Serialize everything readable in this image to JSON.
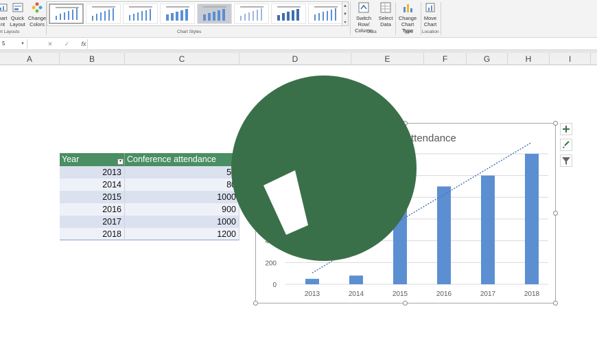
{
  "ribbon": {
    "add_element": {
      "line1": "hart",
      "line2": "nt"
    },
    "quick_layout": {
      "line1": "Quick",
      "line2": "Layout"
    },
    "change_colors": {
      "line1": "Change",
      "line2": "Colors"
    },
    "chart_layouts_label": "rt Layouts",
    "chart_styles_label": "Chart Styles",
    "switch_row_column": {
      "line1": "Switch Row/",
      "line2": "Column"
    },
    "select_data": {
      "line1": "Select",
      "line2": "Data"
    },
    "data_group_label": "Data",
    "change_chart_type": {
      "line1": "Change",
      "line2": "Chart Type"
    },
    "type_group_label": "Type",
    "move_chart": {
      "line1": "Move",
      "line2": "Chart"
    },
    "location_group_label": "Location"
  },
  "formula_bar": {
    "name_box": "5",
    "cancel": "✕",
    "enter": "✓",
    "fx": "fx",
    "value": ""
  },
  "columns": [
    "A",
    "B",
    "C",
    "D",
    "E",
    "F",
    "G",
    "H",
    "I"
  ],
  "table": {
    "headers": [
      "Year",
      "Conference attendance"
    ],
    "rows": [
      [
        "2013",
        "50"
      ],
      [
        "2014",
        "80"
      ],
      [
        "2015",
        "1000"
      ],
      [
        "2016",
        "900"
      ],
      [
        "2017",
        "1000"
      ],
      [
        "2018",
        "1200"
      ]
    ]
  },
  "colors": {
    "header_green": "#4a8e64",
    "bar_blue": "#5b8fd2",
    "overlay_green": "#3a7049"
  },
  "chart_data": {
    "type": "bar",
    "title_visible": "ttendance",
    "categories": [
      "2013",
      "2014",
      "2015",
      "2016",
      "2017",
      "2018"
    ],
    "values": [
      50,
      80,
      1000,
      900,
      1000,
      1200
    ],
    "y_ticks": [
      0,
      200,
      400
    ],
    "ylim": [
      0,
      1200
    ],
    "grid": true,
    "trendline": "dotted",
    "legend": "none"
  },
  "side_buttons": [
    "chart-elements",
    "chart-styles",
    "chart-filters"
  ]
}
